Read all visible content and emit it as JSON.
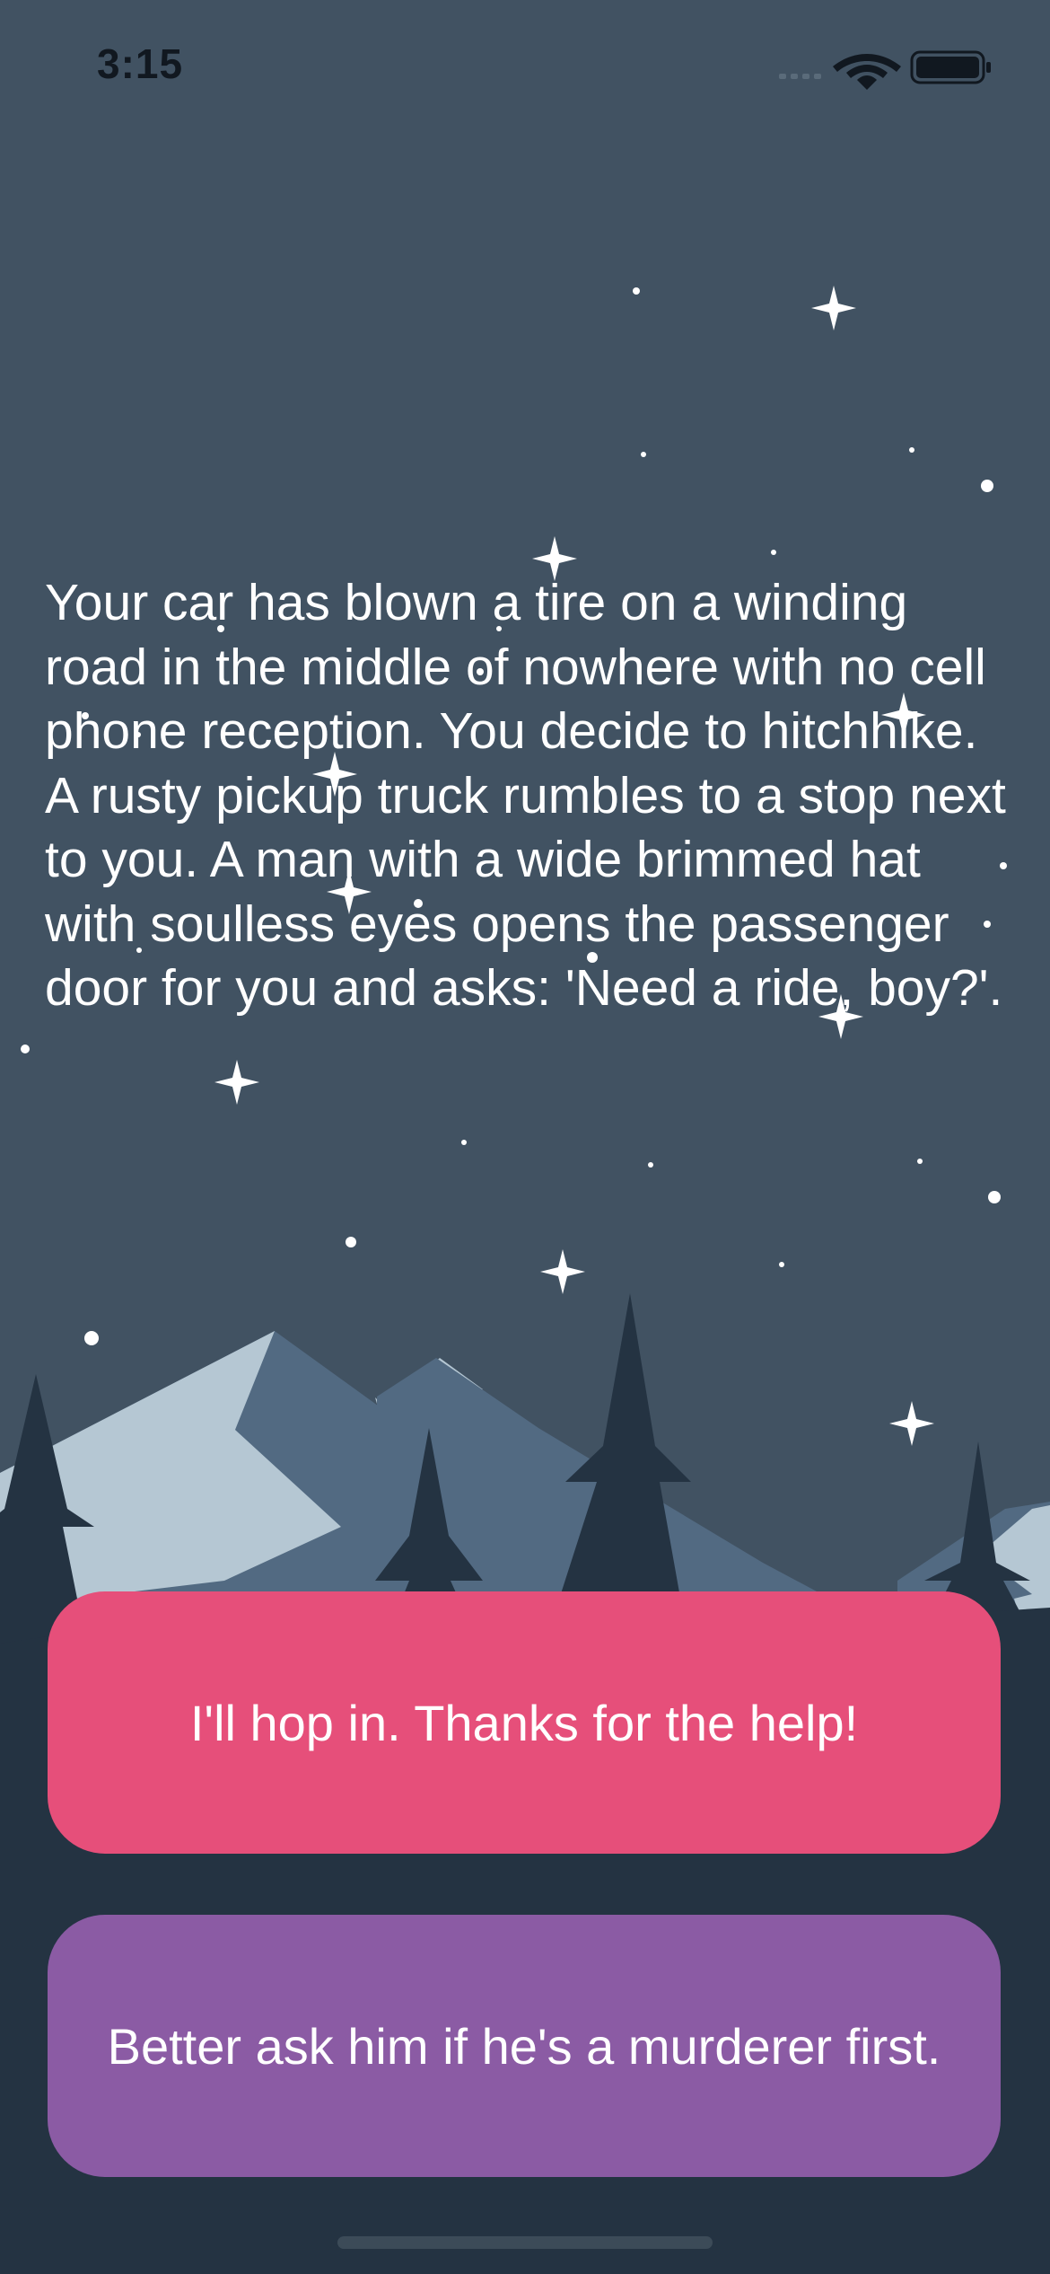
{
  "status_bar": {
    "time": "3:15",
    "icons": [
      "signal-icon",
      "wifi-icon",
      "battery-icon"
    ]
  },
  "story": {
    "text": "Your car has blown a tire on a winding road in the middle of nowhere with no cell phone reception. You decide to hitchhike. A rusty pickup truck rumbles to a stop next to you. A man with a wide brimmed hat with soulless eyes opens the passenger door for you and asks: 'Need a ride, boy?'."
  },
  "choices": [
    {
      "label": "I'll hop in. Thanks for the help!",
      "color": "#e64f7a"
    },
    {
      "label": "Better ask him if he's a murderer first.",
      "color": "#8b5ba4"
    }
  ],
  "colors": {
    "sky": "#415262",
    "mountain_light": "#b5c7d3",
    "mountain_mid": "#526a82",
    "trees_dark": "#243342",
    "trees_far": "#4f6a84"
  }
}
